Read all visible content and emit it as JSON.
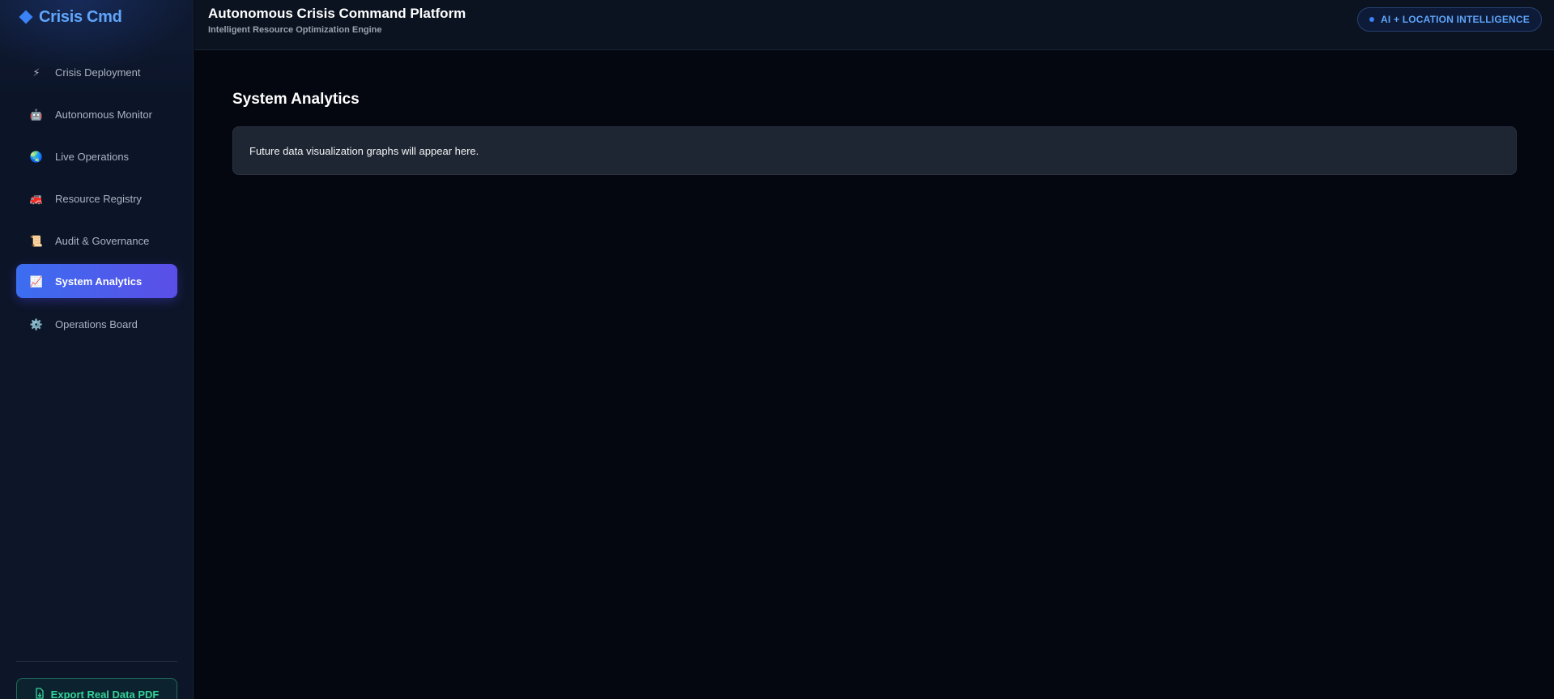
{
  "brand": {
    "name": "Crisis Cmd",
    "icon": "diamond-icon",
    "color": "#60a5fa"
  },
  "sidebar": {
    "items": [
      {
        "label": "Crisis Deployment",
        "icon": "lightning-icon",
        "glyph": "⚡",
        "active": false
      },
      {
        "label": "Autonomous Monitor",
        "icon": "robot-icon",
        "glyph": "🤖",
        "active": false
      },
      {
        "label": "Live Operations",
        "icon": "globe-icon",
        "glyph": "🌏",
        "active": false
      },
      {
        "label": "Resource Registry",
        "icon": "fire-engine-icon",
        "glyph": "🚒",
        "active": false
      },
      {
        "label": "Audit & Governance",
        "icon": "scroll-icon",
        "glyph": "📜",
        "active": false
      },
      {
        "label": "System Analytics",
        "icon": "chart-icon",
        "glyph": "📈",
        "active": true
      },
      {
        "label": "Operations Board",
        "icon": "gear-icon",
        "glyph": "⚙️",
        "active": false
      }
    ],
    "export_label": "Export Real Data PDF",
    "export_icon": "file-export-icon"
  },
  "header": {
    "title": "Autonomous Crisis Command Platform",
    "subtitle": "Intelligent Resource Optimization Engine",
    "badge": "AI + LOCATION INTELLIGENCE"
  },
  "main": {
    "page_title": "System Analytics",
    "card_text": "Future data visualization graphs will appear here."
  },
  "colors": {
    "accent_start": "#3b6ef0",
    "accent_end": "#5b4ee8",
    "export_green": "#34d399",
    "background": "#04070f"
  }
}
